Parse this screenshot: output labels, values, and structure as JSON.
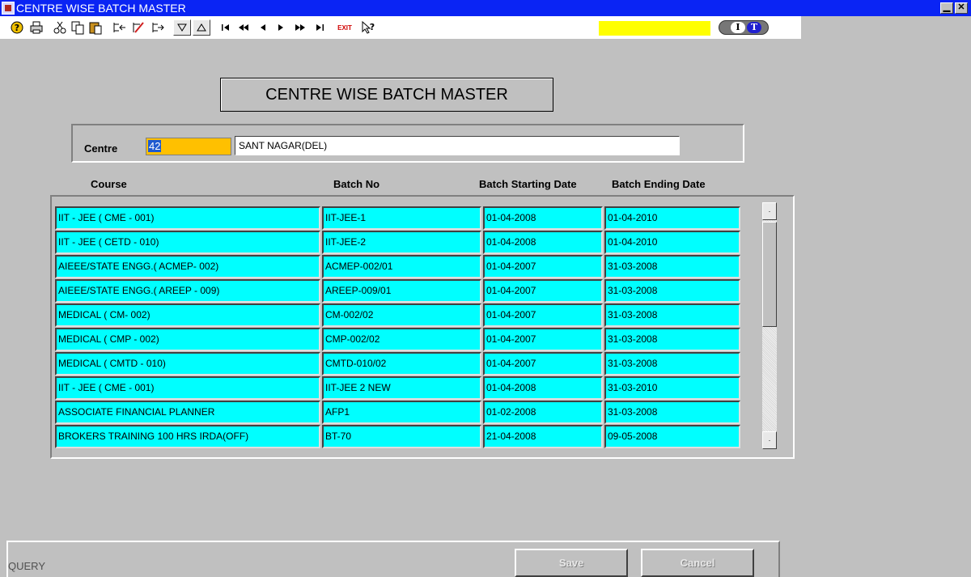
{
  "window": {
    "title": "CENTRE WISE BATCH MASTER",
    "minimize_glyph": "▁",
    "close_glyph": "✕"
  },
  "toolbar": {
    "icons": [
      "help-icon",
      "print-icon",
      "cut-icon",
      "copy-icon",
      "paste-icon",
      "insert-record-icon",
      "edit-record-icon",
      "delete-record-icon",
      "enter-query-icon",
      "execute-query-icon",
      "first-record-icon",
      "previous-set-icon",
      "previous-record-icon",
      "next-record-icon",
      "next-set-icon",
      "last-record-icon",
      "exit-icon",
      "context-help-icon"
    ],
    "exit_label": "EXIT",
    "logo_i": "I",
    "logo_t": "T"
  },
  "form": {
    "title": "CENTRE WISE BATCH MASTER",
    "centre_label": "Centre",
    "centre_code": "42",
    "centre_name": "SANT NAGAR(DEL)"
  },
  "grid": {
    "headers": {
      "course": "Course",
      "batch_no": "Batch No",
      "start": "Batch Starting Date",
      "end": "Batch Ending Date"
    },
    "rows": [
      {
        "course": "IIT - JEE ( CME - 001)",
        "batch": "IIT-JEE-1",
        "start": "01-04-2008",
        "end": "01-04-2010"
      },
      {
        "course": "IIT - JEE ( CETD - 010)",
        "batch": "IIT-JEE-2",
        "start": "01-04-2008",
        "end": "01-04-2010"
      },
      {
        "course": "AIEEE/STATE ENGG.( ACMEP- 002)",
        "batch": "ACMEP-002/01",
        "start": "01-04-2007",
        "end": "31-03-2008"
      },
      {
        "course": "AIEEE/STATE ENGG.( AREEP - 009)",
        "batch": "AREEP-009/01",
        "start": "01-04-2007",
        "end": "31-03-2008"
      },
      {
        "course": "MEDICAL ( CM- 002)",
        "batch": "CM-002/02",
        "start": "01-04-2007",
        "end": "31-03-2008"
      },
      {
        "course": "MEDICAL ( CMP - 002)",
        "batch": "CMP-002/02",
        "start": "01-04-2007",
        "end": "31-03-2008"
      },
      {
        "course": "MEDICAL ( CMTD - 010)",
        "batch": "CMTD-010/02",
        "start": "01-04-2007",
        "end": "31-03-2008"
      },
      {
        "course": "IIT - JEE ( CME - 001)",
        "batch": "IIT-JEE 2 NEW",
        "start": "01-04-2008",
        "end": "31-03-2010"
      },
      {
        "course": "ASSOCIATE FINANCIAL PLANNER",
        "batch": "AFP1",
        "start": "01-02-2008",
        "end": "31-03-2008"
      },
      {
        "course": " BROKERS TRAINING 100 HRS IRDA(OFF)",
        "batch": "BT-70",
        "start": "21-04-2008",
        "end": "09-05-2008"
      }
    ]
  },
  "status": {
    "mode": "QUERY",
    "save_label": "Save",
    "cancel_label": "Cancel"
  },
  "colors": {
    "titlebar": "#0a24f4",
    "grid_cell": "#00ffff",
    "centre_code_bg": "#ffc000",
    "toolbar_indicator": "#ffff00"
  }
}
